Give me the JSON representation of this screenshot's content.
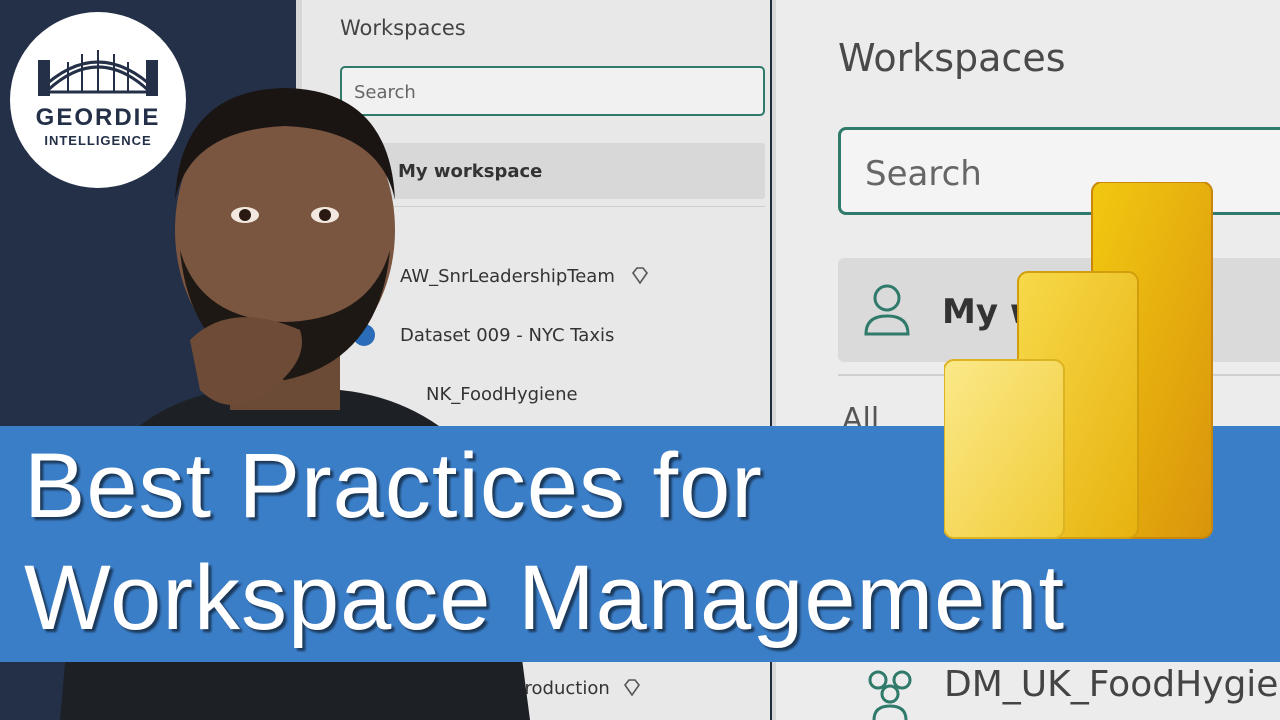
{
  "logo": {
    "line1": "GEORDIE",
    "line2": "INTELLIGENCE"
  },
  "workspace_panel": {
    "title": "Workspaces",
    "search_placeholder": "Search",
    "my_workspace": "My workspace",
    "items": [
      {
        "label": "AW_SnrLeadershipTeam",
        "icon": "top-hat-icon",
        "badge": "premium-diamond-icon"
      },
      {
        "label": "Dataset 009 - NYC Taxis",
        "icon": "globe-icon"
      },
      {
        "label": "NK_FoodHygiene",
        "icon": "group-icon"
      },
      {
        "label": "Production",
        "icon": "group-icon",
        "badge": "premium-diamond-icon"
      }
    ]
  },
  "zoom_panel": {
    "title": "Workspaces",
    "search_placeholder": "Search",
    "my_workspace": "My w",
    "all_label": "All",
    "last_item": "DM_UK_FoodHygiene"
  },
  "banner": {
    "line1": "Best Practices for",
    "line2": "Workspace Management"
  },
  "colors": {
    "banner": "#3b7ec8",
    "accent_teal": "#2f7a6a",
    "pbi_yellow_light": "#f5dd6a",
    "pbi_yellow_mid": "#f2c811",
    "pbi_yellow_dark": "#e0a90c"
  }
}
